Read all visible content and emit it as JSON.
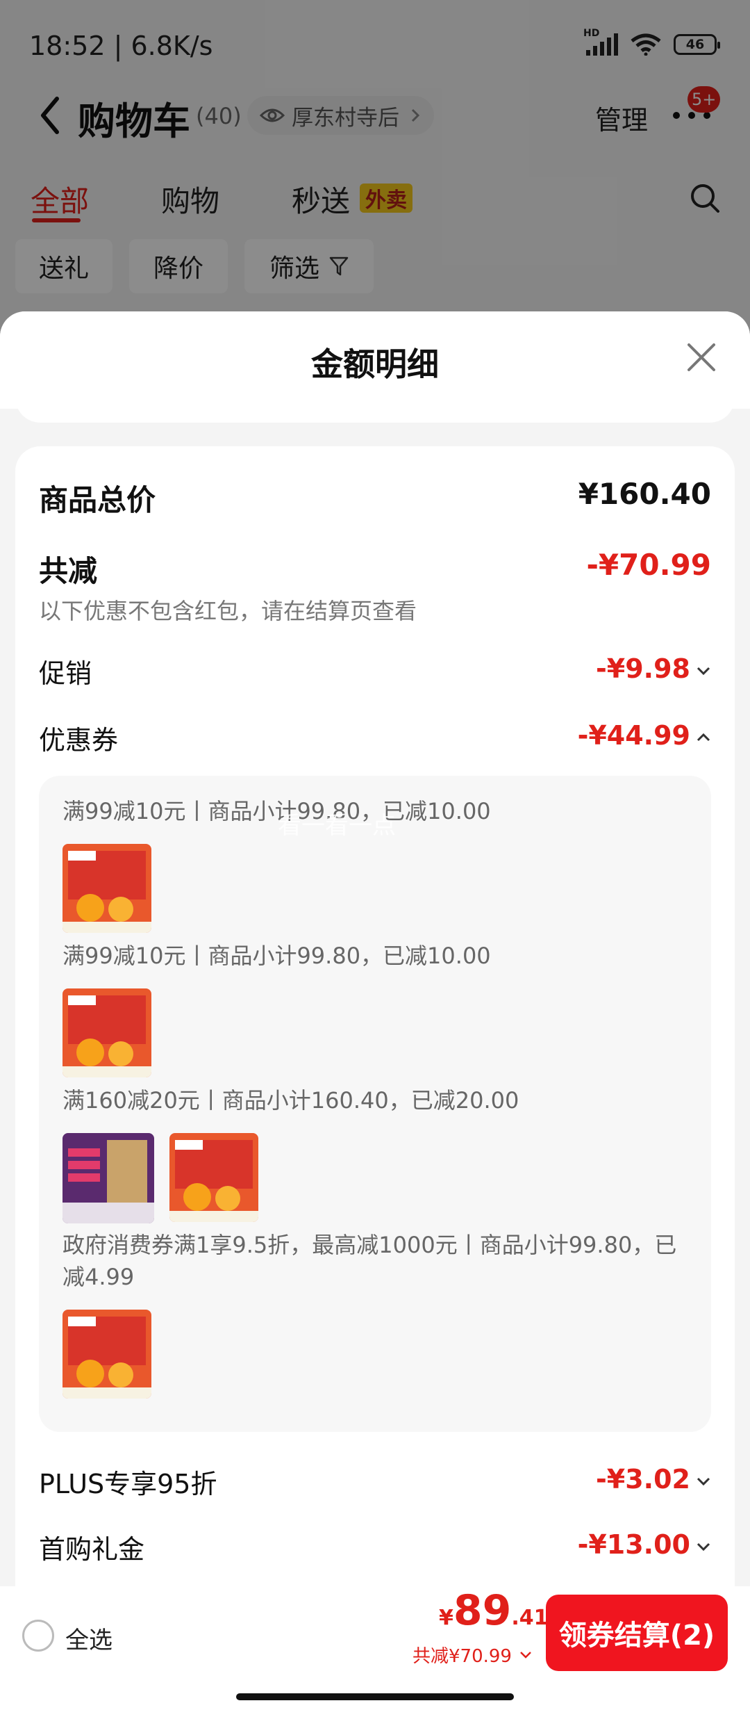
{
  "status_bar": {
    "time": "18:52 | 6.8K/s",
    "network": "HD",
    "battery": "46"
  },
  "header": {
    "title": "购物车",
    "count": "(40)",
    "location": "厚东村寺后",
    "manage": "管理",
    "badge": "5+"
  },
  "tabs": [
    {
      "label": "全部",
      "active": true
    },
    {
      "label": "购物",
      "active": false
    },
    {
      "label": "秒送",
      "active": false
    }
  ],
  "tab_tag": "外卖",
  "chips": [
    "送礼",
    "降价",
    "筛选"
  ],
  "sheet": {
    "title": "金额明细",
    "total_label": "商品总价",
    "total_value": "¥160.40",
    "reduce_label": "共减",
    "reduce_value": "-¥70.99",
    "reduce_note": "以下优惠不包含红包，请在结算页查看",
    "promo_label": "促销",
    "promo_value": "-¥9.98",
    "coupon_label": "优惠券",
    "coupon_value": "-¥44.99",
    "coupons": [
      "满99减10元丨商品小计99.80，已减10.00",
      "满99减10元丨商品小计99.80，已减10.00",
      "满160减20元丨商品小计160.40，已减20.00",
      "政府消费券满1享9.5折，最高减1000元丨商品小计99.80，已减4.99"
    ],
    "plus_label": "PLUS专享95折",
    "plus_value": "-¥3.02",
    "first_label": "首购礼金",
    "first_value": "-¥13.00",
    "watermark": "看一看一点"
  },
  "bottom_bar": {
    "select_all": "全选",
    "price_yen": "¥",
    "price_int": "89",
    "price_dec": ".41",
    "saved": "共减¥70.99",
    "checkout": "领券结算(2)"
  },
  "colors": {
    "accent": "#e0201a",
    "button": "#f0151f",
    "tag_bg": "#f4c91c"
  }
}
